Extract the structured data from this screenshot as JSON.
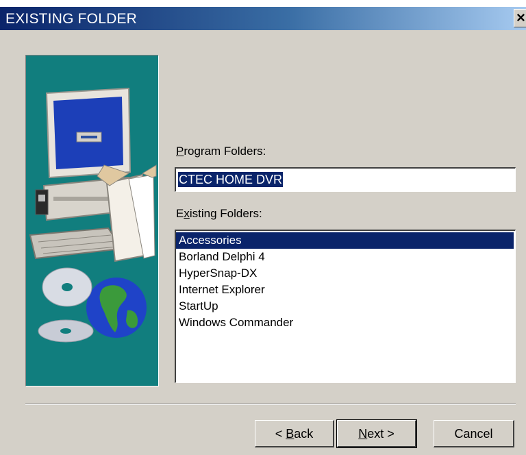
{
  "window": {
    "title": "EXISTING FOLDER",
    "close_label": "×"
  },
  "program_folders": {
    "label_mnemonic": "P",
    "label_rest": "rogram Folders:",
    "value": "CTEC HOME DVR"
  },
  "existing_folders": {
    "label_pre": "E",
    "label_mnemonic": "x",
    "label_rest": "isting Folders:",
    "items": [
      "Accessories",
      "Borland Delphi 4",
      "HyperSnap-DX",
      "Internet Explorer",
      "StartUp",
      "Windows Commander"
    ],
    "selected_index": 0
  },
  "buttons": {
    "back_prefix": "< ",
    "back_mnemonic": "B",
    "back_rest": "ack",
    "next_mnemonic": "N",
    "next_rest": "ext >",
    "cancel": "Cancel"
  },
  "colors": {
    "title_start": "#0a246a",
    "title_end": "#a6caf0",
    "banner": "#117e7e",
    "face": "#d4d0c8",
    "highlight": "#0a246a"
  }
}
